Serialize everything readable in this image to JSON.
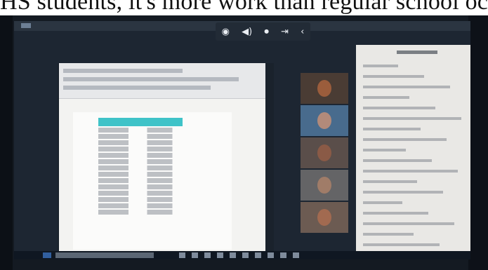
{
  "caption": "HS students, it's more work than regular school oc",
  "meeting_controls": {
    "icons": [
      "chrome-icon",
      "volume-icon",
      "media-icon",
      "exit-icon",
      "chevron-left-icon"
    ],
    "glyphs": [
      "◉",
      "◀)",
      "⏺",
      "⇥",
      "‹"
    ]
  },
  "shared_document": {
    "table_header_color": "#3fc3c8"
  },
  "participants_count": 5,
  "chat_panel": {
    "message_count": 18
  }
}
